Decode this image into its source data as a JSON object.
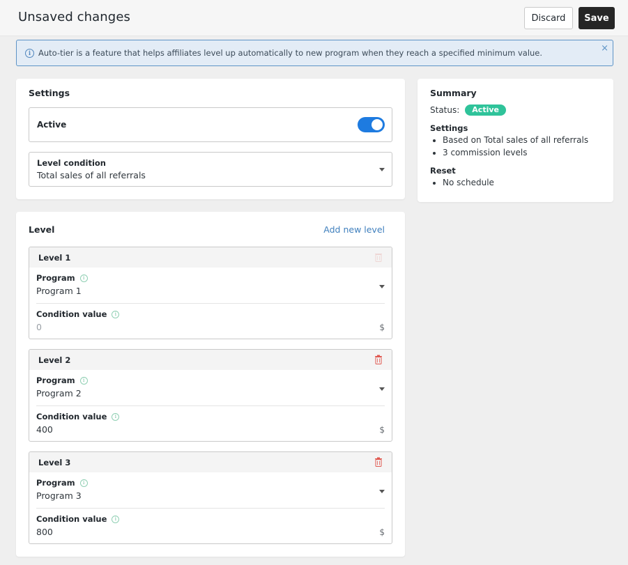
{
  "header": {
    "title": "Unsaved changes",
    "discard_label": "Discard",
    "save_label": "Save"
  },
  "banner": {
    "icon": "info-icon",
    "text": "Auto-tier is a feature that helps affiliates level up automatically to new program when they reach a specified minimum value.",
    "close_icon": "×"
  },
  "settings": {
    "heading": "Settings",
    "active_label": "Active",
    "active_enabled": true,
    "level_condition_label": "Level condition",
    "level_condition_value": "Total sales of all referrals"
  },
  "summary": {
    "heading": "Summary",
    "status_label": "Status:",
    "status_value": "Active",
    "status_color": "#2fc39a",
    "settings_heading": "Settings",
    "settings_items": [
      "Based on Total sales of all referrals",
      "3 commission levels"
    ],
    "reset_heading": "Reset",
    "reset_items": [
      "No schedule"
    ]
  },
  "level_section": {
    "heading": "Level",
    "add_label": "Add new level",
    "program_label": "Program",
    "condition_label": "Condition value",
    "currency": "$",
    "levels": [
      {
        "title": "Level 1",
        "program": "Program 1",
        "condition_value": "",
        "condition_placeholder": "0",
        "delete_enabled": false
      },
      {
        "title": "Level 2",
        "program": "Program 2",
        "condition_value": "400",
        "condition_placeholder": "0",
        "delete_enabled": true
      },
      {
        "title": "Level 3",
        "program": "Program 3",
        "condition_value": "800",
        "condition_placeholder": "0",
        "delete_enabled": true
      }
    ]
  },
  "colors": {
    "accent": "#1e7be0",
    "link": "#3f7fbd",
    "danger": "#e0574f",
    "success": "#2fc39a"
  }
}
